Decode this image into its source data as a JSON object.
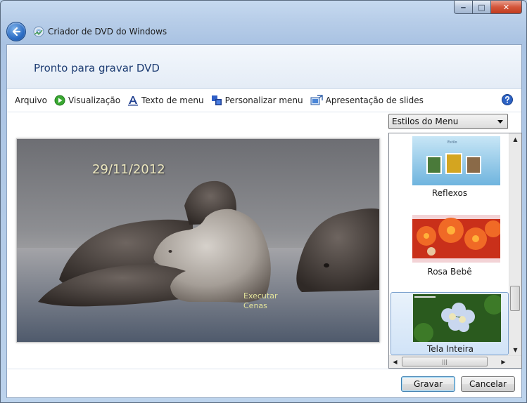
{
  "window": {
    "title": "Criador de DVD do Windows",
    "caption": {
      "minimize": "‒",
      "maximize": "□",
      "close": "✕"
    }
  },
  "header": {
    "title": "Pronto para gravar DVD"
  },
  "toolbar": {
    "items": [
      {
        "label": "Arquivo",
        "icon": "none"
      },
      {
        "label": "Visualização",
        "icon": "play-icon"
      },
      {
        "label": "Texto de menu",
        "icon": "text-a-icon"
      },
      {
        "label": "Personalizar menu",
        "icon": "customize-icon"
      },
      {
        "label": "Apresentação de slides",
        "icon": "slideshow-icon"
      }
    ],
    "help_icon": "help-icon"
  },
  "preview": {
    "date_text": "29/11/2012",
    "play_label_line1": "Executar",
    "play_label_line2": "Cenas"
  },
  "styles": {
    "dropdown_selected": "Estilos do Menu",
    "items": [
      {
        "label": "Reflexos",
        "selected": false
      },
      {
        "label": "Rosa Bebê",
        "selected": false
      },
      {
        "label": "Tela Inteira",
        "selected": true
      }
    ],
    "thumb_caption": "Estilo"
  },
  "buttons": {
    "burn": "Gravar",
    "cancel": "Cancelar"
  },
  "colors": {
    "accent": "#1e3d73",
    "selection": "#d1e3f7",
    "close": "#c23b1f"
  }
}
